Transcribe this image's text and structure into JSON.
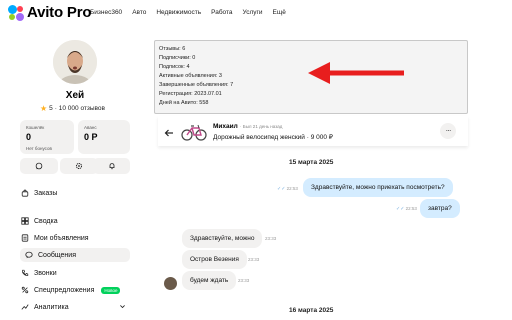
{
  "topbar": {
    "logo_text": "Avito Pro",
    "nav": [
      "Бизнес360",
      "Авто",
      "Недвижимость",
      "Работа",
      "Услуги",
      "Ещё"
    ]
  },
  "profile": {
    "name": "Хей",
    "rating": "5",
    "reviews": "· 10 000 отзывов",
    "wallet": {
      "label": "Кошелёк",
      "value": "0",
      "sub": "Нет бонусов"
    },
    "advance": {
      "label": "Аванс",
      "value": "0 Р"
    }
  },
  "sidebar": {
    "items": [
      {
        "label": "Заказы",
        "icon": "bag-icon"
      },
      {
        "label": "Сводка",
        "icon": "grid-icon"
      },
      {
        "label": "Мои объявления",
        "icon": "list-icon"
      },
      {
        "label": "Сообщения",
        "icon": "chat-icon"
      },
      {
        "label": "Звонки",
        "icon": "phone-icon"
      },
      {
        "label": "Спецпредложения",
        "icon": "percent-icon",
        "badge": "Новое"
      },
      {
        "label": "Аналитика",
        "icon": "chart-icon"
      }
    ]
  },
  "info_box": {
    "lines": [
      "Отзывы: 6",
      "Подписчики: 0",
      "Подписок: 4",
      "Активные объявления: 3",
      "Завершенные объявления: 7",
      "Регистрация: 2023.07.01",
      "Дней на Авито: 558"
    ]
  },
  "chat": {
    "name": "Михаил",
    "seen": "· Был 21 день назад",
    "item": "Дорожный велосипед женский · 9 000 ₽",
    "date1": "15 марта 2025",
    "date2": "16 марта 2025",
    "messages": {
      "out1": {
        "text": "Здравствуйте, можно приехать посмотреть?",
        "time": "22:53"
      },
      "out2": {
        "text": "завтра?",
        "time": "22:53"
      },
      "in1": {
        "text": "Здравствуйте, можно",
        "time": "23:33"
      },
      "in2": {
        "text": "Остров Везения",
        "time": "23:33"
      },
      "in3": {
        "text": "будем ждать",
        "time": "23:33"
      }
    }
  },
  "colors": {
    "accent_red": "#e81e1e",
    "outgoing_bubble": "#d4ecff",
    "badge_green": "#02d15c",
    "star": "#ffb021"
  }
}
